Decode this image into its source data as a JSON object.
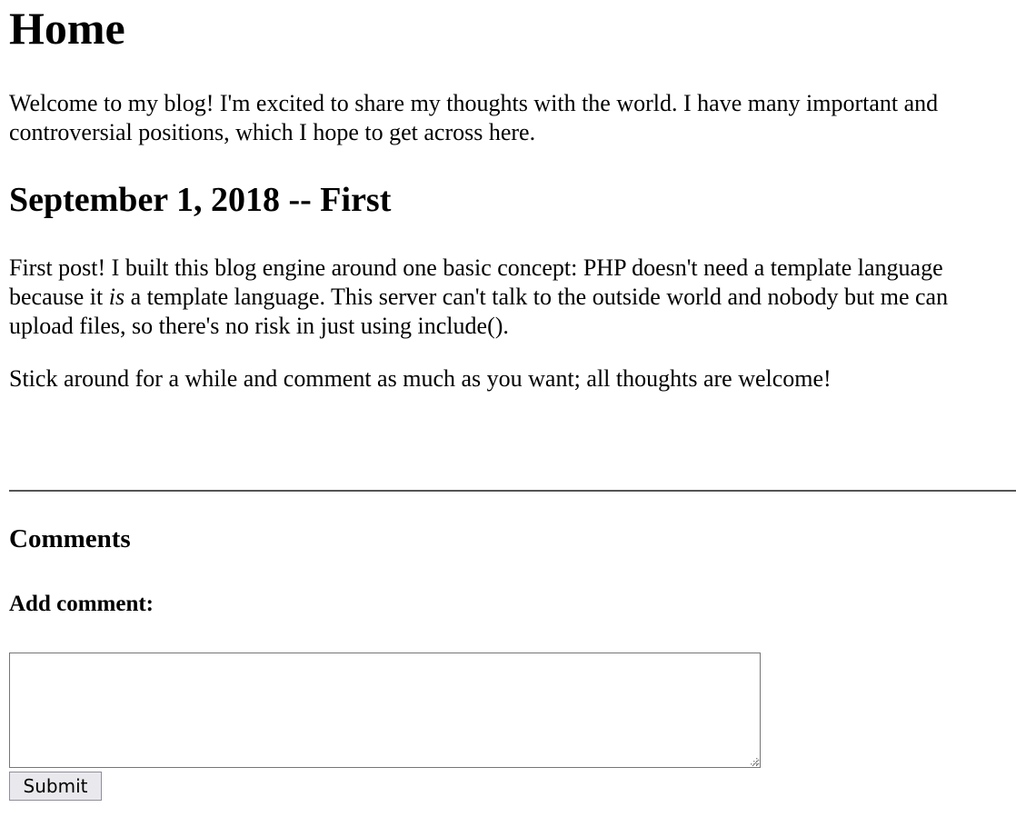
{
  "page": {
    "title": "Home",
    "intro": "Welcome to my blog! I'm excited to share my thoughts with the world. I have many important and controversial positions, which I hope to get across here."
  },
  "post": {
    "title": "September 1, 2018 -- First",
    "p1_before": "First post! I built this blog engine around one basic concept: PHP doesn't need a template language because it ",
    "p1_emphasis": "is",
    "p1_after": " a template language. This server can't talk to the outside world and nobody but me can upload files, so there's no risk in just using include().",
    "p2": "Stick around for a while and comment as much as you want; all thoughts are welcome!"
  },
  "comments": {
    "heading": "Comments",
    "add_label": "Add comment:",
    "textarea_value": "",
    "submit_label": "Submit"
  },
  "icons": {
    "resize_grip": "resize-grip-icon"
  },
  "colors": {
    "divider": "#555555",
    "textarea_border": "#767676",
    "button_background": "#e9e9ed",
    "button_border": "#8f8f9d"
  }
}
